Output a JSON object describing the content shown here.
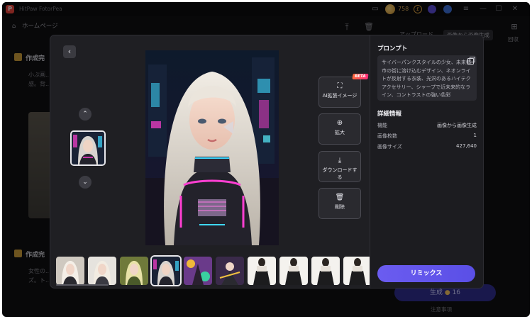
{
  "app": {
    "title": "HitPaw FotorPea",
    "credits": "758"
  },
  "header": {
    "home_label": "ホームページ"
  },
  "background": {
    "upload_label": "アップロード",
    "tab_label": "画像から画像生成",
    "right_panel_label": "回収",
    "cards": [
      {
        "title": "作成完",
        "lines": [
          "小ぶ画...",
          "感。背..."
        ]
      },
      {
        "title": "作成完",
        "lines": [
          "女性の...",
          "ズ。ト..."
        ]
      }
    ],
    "generate_label": "生成",
    "generate_cost": "16",
    "note": "注意事項"
  },
  "modal": {
    "tools": [
      {
        "icon": "ai-expand-icon",
        "label": "AI拡張イメージ",
        "badge": "BETA"
      },
      {
        "icon": "zoom-in-icon",
        "label": "拡大"
      },
      {
        "icon": "download-icon",
        "label": "ダウンロードする"
      },
      {
        "icon": "trash-icon",
        "label": "削除"
      }
    ],
    "prompt_title": "プロンプト",
    "prompt_text": "サイバーパンクスタイルの少女、未来都市の街に溶け込むデザイン、ネオンライトが反射する衣装、光沢のあるハイテクアクセサリー、シャープで近未来的なライン、コントラストの強い色彩",
    "details_title": "詳細情報",
    "details": [
      {
        "key": "機能",
        "value": "画像から画像生成"
      },
      {
        "key": "画像枚数",
        "value": "1"
      },
      {
        "key": "画像サイズ",
        "value": "427,640"
      }
    ],
    "remix_label": "リミックス"
  },
  "colors": {
    "accent": "#6b5cf0",
    "neon_cyan": "#3fd8ff",
    "neon_magenta": "#ff3fd2",
    "modal_bg": "#1f1f23"
  }
}
